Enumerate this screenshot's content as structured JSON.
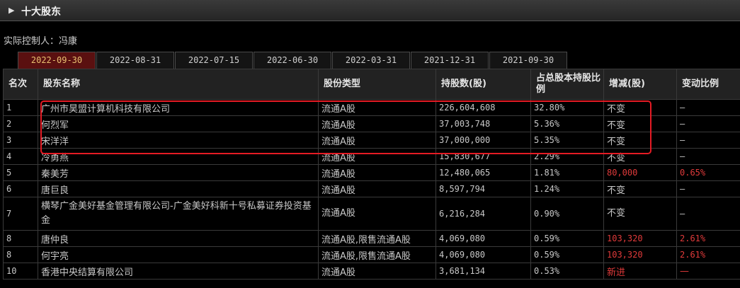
{
  "panel": {
    "title": "十大股东"
  },
  "controller": "实际控制人：冯康",
  "tabs": [
    {
      "label": "2022-09-30",
      "active": true
    },
    {
      "label": "2022-08-31",
      "active": false
    },
    {
      "label": "2022-07-15",
      "active": false
    },
    {
      "label": "2022-06-30",
      "active": false
    },
    {
      "label": "2022-03-31",
      "active": false
    },
    {
      "label": "2021-12-31",
      "active": false
    },
    {
      "label": "2021-09-30",
      "active": false
    }
  ],
  "columns": [
    "名次",
    "股东名称",
    "股份类型",
    "持股数(股)",
    "占总股本持股比例",
    "增减(股)",
    "变动比例"
  ],
  "rows": [
    {
      "rank": "1",
      "name": "广州市昊盟计算机科技有限公司",
      "type": "流通A股",
      "shares": "226,604,608",
      "pct": "32.80%",
      "change": "不变",
      "ratio": "—"
    },
    {
      "rank": "2",
      "name": "何烈军",
      "type": "流通A股",
      "shares": "37,003,748",
      "pct": "5.36%",
      "change": "不变",
      "ratio": "—"
    },
    {
      "rank": "3",
      "name": "宋洋洋",
      "type": "流通A股",
      "shares": "37,000,000",
      "pct": "5.35%",
      "change": "不变",
      "ratio": "—"
    },
    {
      "rank": "4",
      "name": "冷勇燕",
      "type": "流通A股",
      "shares": "15,830,677",
      "pct": "2.29%",
      "change": "不变",
      "ratio": "—"
    },
    {
      "rank": "5",
      "name": "秦美芳",
      "type": "流通A股",
      "shares": "12,480,065",
      "pct": "1.81%",
      "change": "80,000",
      "ratio": "0.65%"
    },
    {
      "rank": "6",
      "name": "唐巨良",
      "type": "流通A股",
      "shares": "8,597,794",
      "pct": "1.24%",
      "change": "不变",
      "ratio": "—"
    },
    {
      "rank": "7",
      "name": "横琴广金美好基金管理有限公司-广金美好科新十号私募证券投资基金",
      "type": "流通A股",
      "shares": "6,216,284",
      "pct": "0.90%",
      "change": "不变",
      "ratio": "—"
    },
    {
      "rank": "8",
      "name": "唐仲良",
      "type": "流通A股,限售流通A股",
      "shares": "4,069,080",
      "pct": "0.59%",
      "change": "103,320",
      "ratio": "2.61%"
    },
    {
      "rank": "8",
      "name": "何宇亮",
      "type": "流通A股,限售流通A股",
      "shares": "4,069,080",
      "pct": "0.59%",
      "change": "103,320",
      "ratio": "2.61%"
    },
    {
      "rank": "10",
      "name": "香港中央结算有限公司",
      "type": "流通A股",
      "shares": "3,681,134",
      "pct": "0.53%",
      "change": "新进",
      "ratio": "—"
    }
  ],
  "colors": {
    "active_tab_bg": "#5a1010",
    "increase": "#e03a3a",
    "highlight_box": "#e51b24"
  }
}
